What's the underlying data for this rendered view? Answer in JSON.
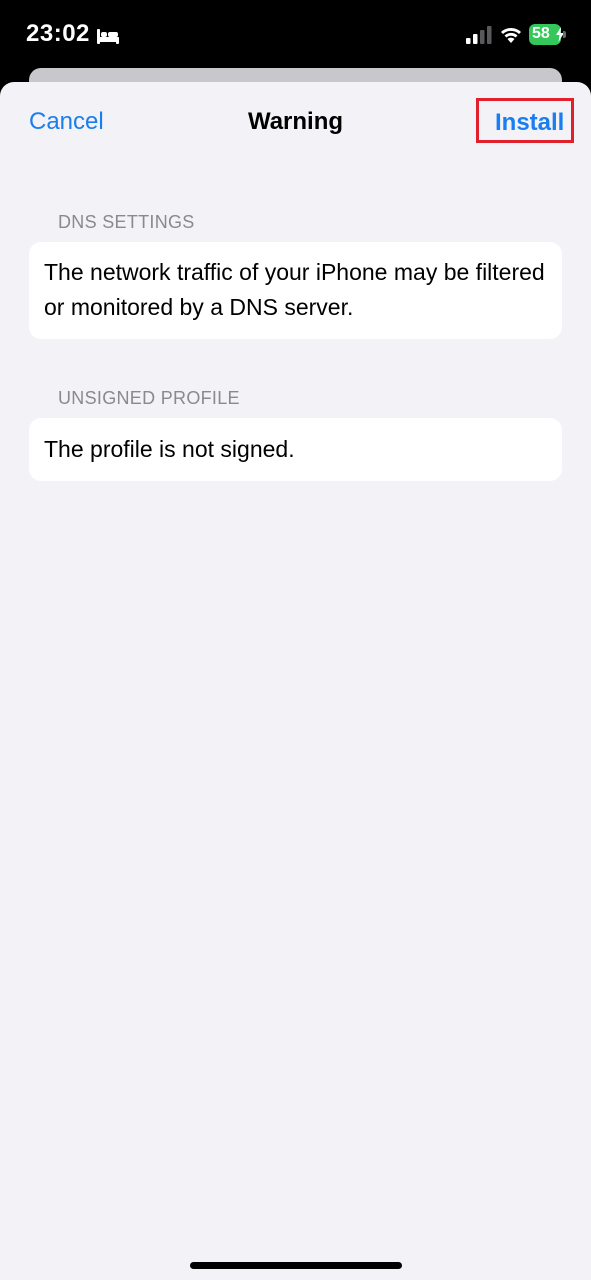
{
  "status_bar": {
    "time": "23:02",
    "battery_percent": "58",
    "icons": [
      "bed-icon",
      "cellular-signal-icon",
      "wifi-icon",
      "battery-charging-icon"
    ]
  },
  "nav": {
    "cancel_label": "Cancel",
    "title": "Warning",
    "install_label": "Install"
  },
  "sections": [
    {
      "header": "DNS SETTINGS",
      "body": "The network traffic of your iPhone may be filtered or monitored by a DNS server."
    },
    {
      "header": "UNSIGNED PROFILE",
      "body": "The profile is not signed."
    }
  ],
  "colors": {
    "accent": "#1a7ef0",
    "highlight_box": "#e0202b",
    "battery": "#34c759",
    "background": "#f2f2f7"
  }
}
